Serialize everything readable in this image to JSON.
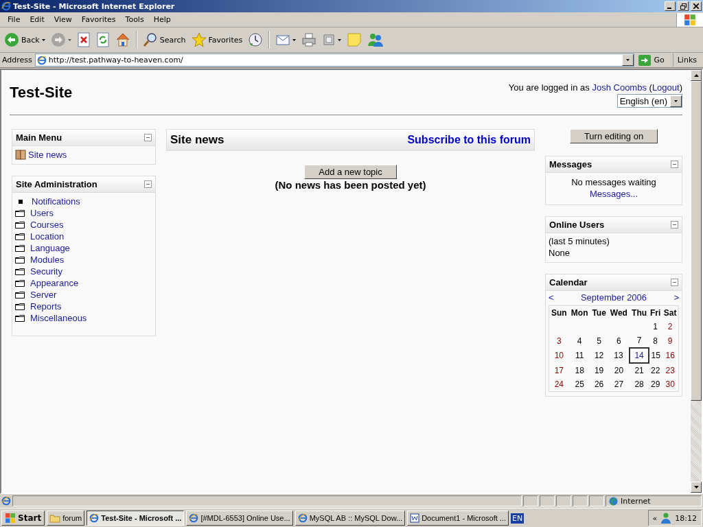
{
  "window": {
    "title": "Test-Site - Microsoft Internet Explorer"
  },
  "menu": [
    "File",
    "Edit",
    "View",
    "Favorites",
    "Tools",
    "Help"
  ],
  "toolbar": {
    "groups": [
      [
        {
          "kind": "back",
          "label": "Back",
          "dropdown": true,
          "disabled": false
        },
        {
          "kind": "forward",
          "dropdown": true,
          "disabled": true
        },
        {
          "kind": "stop",
          "dropdown": false,
          "disabled": false
        },
        {
          "kind": "refresh",
          "dropdown": false,
          "disabled": false
        },
        {
          "kind": "home",
          "dropdown": false,
          "disabled": false
        }
      ],
      [
        {
          "kind": "search",
          "label": "Search",
          "dropdown": false,
          "disabled": false
        },
        {
          "kind": "favorites",
          "label": "Favorites",
          "dropdown": false,
          "disabled": false
        },
        {
          "kind": "history",
          "dropdown": false,
          "disabled": false
        }
      ],
      [
        {
          "kind": "mail",
          "dropdown": true,
          "disabled": false
        },
        {
          "kind": "print",
          "dropdown": false,
          "disabled": false
        },
        {
          "kind": "edit",
          "dropdown": true,
          "disabled": false
        },
        {
          "kind": "note",
          "dropdown": false,
          "disabled": false
        },
        {
          "kind": "messenger",
          "dropdown": false,
          "disabled": false
        }
      ]
    ]
  },
  "address_bar": {
    "label": "Address",
    "value": "http://test.pathway-to-heaven.com/",
    "go": "Go",
    "links": "Links"
  },
  "page": {
    "site_title": "Test-Site",
    "login": {
      "prefix": "You are logged in as",
      "user": "Josh Coombs",
      "paren_open": "(",
      "logout": "Logout",
      "paren_close": ")"
    },
    "language": "English (en)",
    "main_menu": {
      "title": "Main Menu",
      "items": [
        "Site news"
      ]
    },
    "site_admin": {
      "title": "Site Administration",
      "items": [
        {
          "label": "Notifications",
          "kind": "bullet"
        },
        {
          "label": "Users",
          "kind": "folder"
        },
        {
          "label": "Courses",
          "kind": "folder"
        },
        {
          "label": "Location",
          "kind": "folder"
        },
        {
          "label": "Language",
          "kind": "folder"
        },
        {
          "label": "Modules",
          "kind": "folder"
        },
        {
          "label": "Security",
          "kind": "folder"
        },
        {
          "label": "Appearance",
          "kind": "folder"
        },
        {
          "label": "Server",
          "kind": "folder"
        },
        {
          "label": "Reports",
          "kind": "folder"
        },
        {
          "label": "Miscellaneous",
          "kind": "folder"
        }
      ]
    },
    "news": {
      "title": "Site news",
      "subscribe": "Subscribe to this forum",
      "add_button": "Add a new topic",
      "empty": "(No news has been posted yet)"
    },
    "editing_button": "Turn editing on",
    "messages": {
      "title": "Messages",
      "text": "No messages waiting",
      "link": "Messages..."
    },
    "online_users": {
      "title": "Online Users",
      "period": "(last 5 minutes)",
      "users": "None"
    },
    "calendar": {
      "title": "Calendar",
      "prev": "<",
      "month": "September 2006",
      "next": ">",
      "weekdays": [
        "Sun",
        "Mon",
        "Tue",
        "Wed",
        "Thu",
        "Fri",
        "Sat"
      ],
      "weeks": [
        {
          "days": [
            {
              "day": "1",
              "weekend": false,
              "today": false
            },
            {
              "day": "2",
              "weekend": true,
              "today": false
            }
          ]
        },
        {
          "days": [
            {
              "day": "3",
              "weekend": true,
              "today": false
            },
            {
              "day": "4",
              "weekend": false,
              "today": false
            },
            {
              "day": "5",
              "weekend": false,
              "today": false
            },
            {
              "day": "6",
              "weekend": false,
              "today": false
            },
            {
              "day": "7",
              "weekend": false,
              "today": false
            },
            {
              "day": "8",
              "weekend": false,
              "today": false
            },
            {
              "day": "9",
              "weekend": true,
              "today": false
            }
          ]
        },
        {
          "days": [
            {
              "day": "10",
              "weekend": true,
              "today": false
            },
            {
              "day": "11",
              "weekend": false,
              "today": false
            },
            {
              "day": "12",
              "weekend": false,
              "today": false
            },
            {
              "day": "13",
              "weekend": false,
              "today": false
            },
            {
              "day": "14",
              "weekend": false,
              "today": true
            },
            {
              "day": "15",
              "weekend": false,
              "today": false
            },
            {
              "day": "16",
              "weekend": true,
              "today": false
            }
          ]
        },
        {
          "days": [
            {
              "day": "17",
              "weekend": true,
              "today": false
            },
            {
              "day": "18",
              "weekend": false,
              "today": false
            },
            {
              "day": "19",
              "weekend": false,
              "today": false
            },
            {
              "day": "20",
              "weekend": false,
              "today": false
            },
            {
              "day": "21",
              "weekend": false,
              "today": false
            },
            {
              "day": "22",
              "weekend": false,
              "today": false
            },
            {
              "day": "23",
              "weekend": true,
              "today": false
            }
          ]
        },
        {
          "days": [
            {
              "day": "24",
              "weekend": true,
              "today": false
            },
            {
              "day": "25",
              "weekend": false,
              "today": false
            },
            {
              "day": "26",
              "weekend": false,
              "today": false
            },
            {
              "day": "27",
              "weekend": false,
              "today": false
            },
            {
              "day": "28",
              "weekend": false,
              "today": false
            },
            {
              "day": "29",
              "weekend": false,
              "today": false
            },
            {
              "day": "30",
              "weekend": true,
              "today": false
            }
          ]
        }
      ]
    }
  },
  "status_bar": {
    "zone": "Internet"
  },
  "taskbar": {
    "start": "Start",
    "tasks": [
      {
        "label": "forum",
        "kind": "folder",
        "selected": false
      },
      {
        "label": "Test-Site - Microsoft ...",
        "kind": "ie",
        "selected": true
      },
      {
        "label": "[#MDL-6553] Online Use...",
        "kind": "ie",
        "selected": false
      },
      {
        "label": "MySQL AB :: MySQL Dow...",
        "kind": "ie",
        "selected": false
      },
      {
        "label": "Document1 - Microsoft ...",
        "kind": "word",
        "selected": false
      }
    ],
    "language": "EN",
    "expand": "«",
    "clock": "18:12"
  }
}
